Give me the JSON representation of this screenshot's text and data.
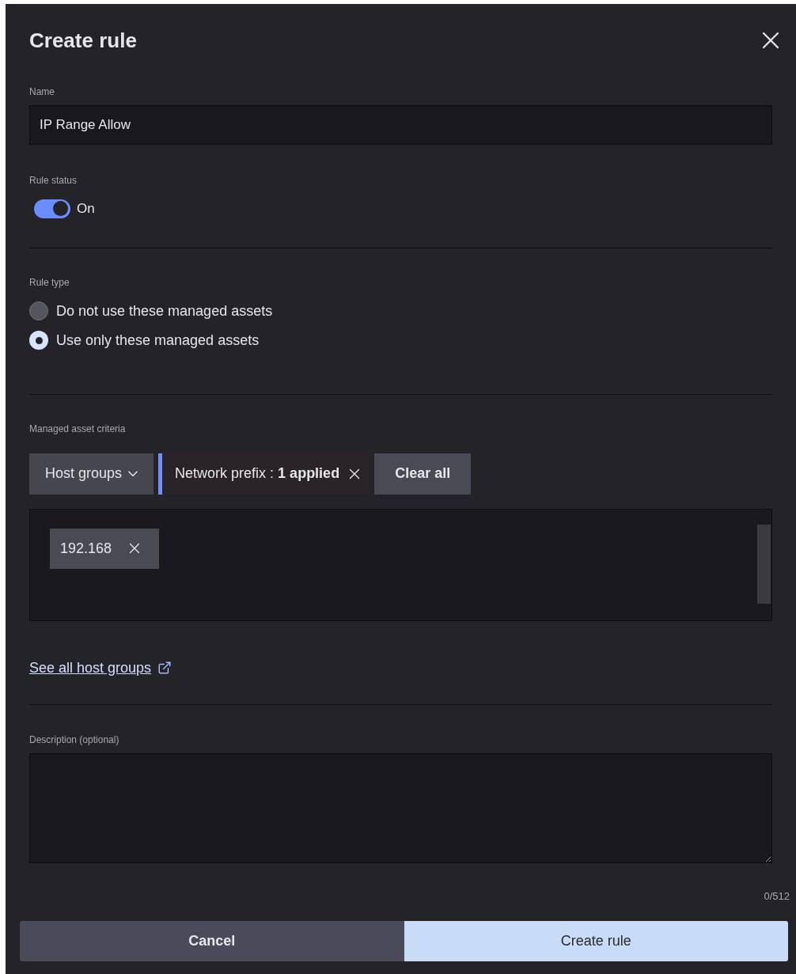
{
  "dialog": {
    "title": "Create rule"
  },
  "name_field": {
    "label": "Name",
    "value": "IP Range Allow"
  },
  "rule_status": {
    "label": "Rule status",
    "on": true,
    "text": "On"
  },
  "rule_type": {
    "label": "Rule type",
    "options": [
      {
        "label": "Do not use these managed assets",
        "selected": false
      },
      {
        "label": "Use only these managed assets",
        "selected": true
      }
    ]
  },
  "criteria": {
    "label": "Managed asset criteria",
    "dropdown": "Host groups",
    "filter_chip": "Network prefix : **1 applied**",
    "clear_button": "Clear all",
    "tags": [
      {
        "label": "192.168"
      }
    ],
    "link": "See all host groups"
  },
  "description": {
    "label": "Description (optional)",
    "counter": "0/512"
  },
  "buttons": {
    "cancel": "Cancel",
    "create": "Create rule"
  }
}
